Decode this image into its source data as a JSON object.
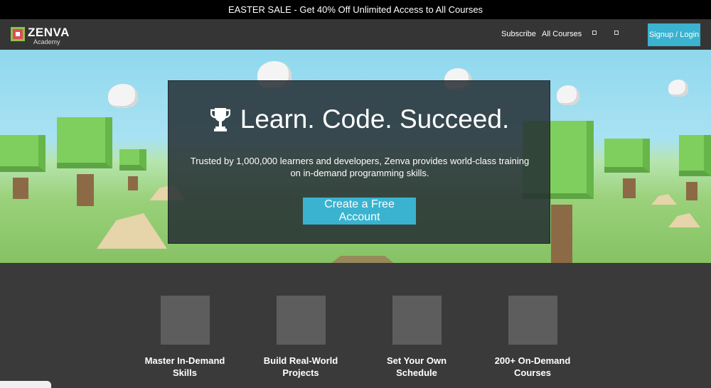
{
  "promo": {
    "text": "EASTER SALE - Get 40% Off Unlimited Access to All Courses"
  },
  "header": {
    "logo_name": "ZENVA",
    "logo_sub": "Academy",
    "links": [
      "Subscribe",
      "All Courses"
    ],
    "signup_label": "Signup / Login"
  },
  "hero": {
    "headline": "Learn. Code. Succeed.",
    "tagline_line1": "Trusted by 1,000,000 learners and developers, Zenva provides world-class training",
    "tagline_line2": "on in-demand programming skills.",
    "cta_label": "Create a Free Account"
  },
  "features": [
    {
      "line1": "Master In-Demand",
      "line2": "Skills"
    },
    {
      "line1": "Build Real-World",
      "line2": "Projects"
    },
    {
      "line1": "Set Your Own",
      "line2": "Schedule"
    },
    {
      "line1": "200+ On-Demand",
      "line2": "Courses"
    }
  ],
  "colors": {
    "accent": "#3ab3d0",
    "nav_bg": "#353535",
    "promo_bg": "#000000"
  }
}
